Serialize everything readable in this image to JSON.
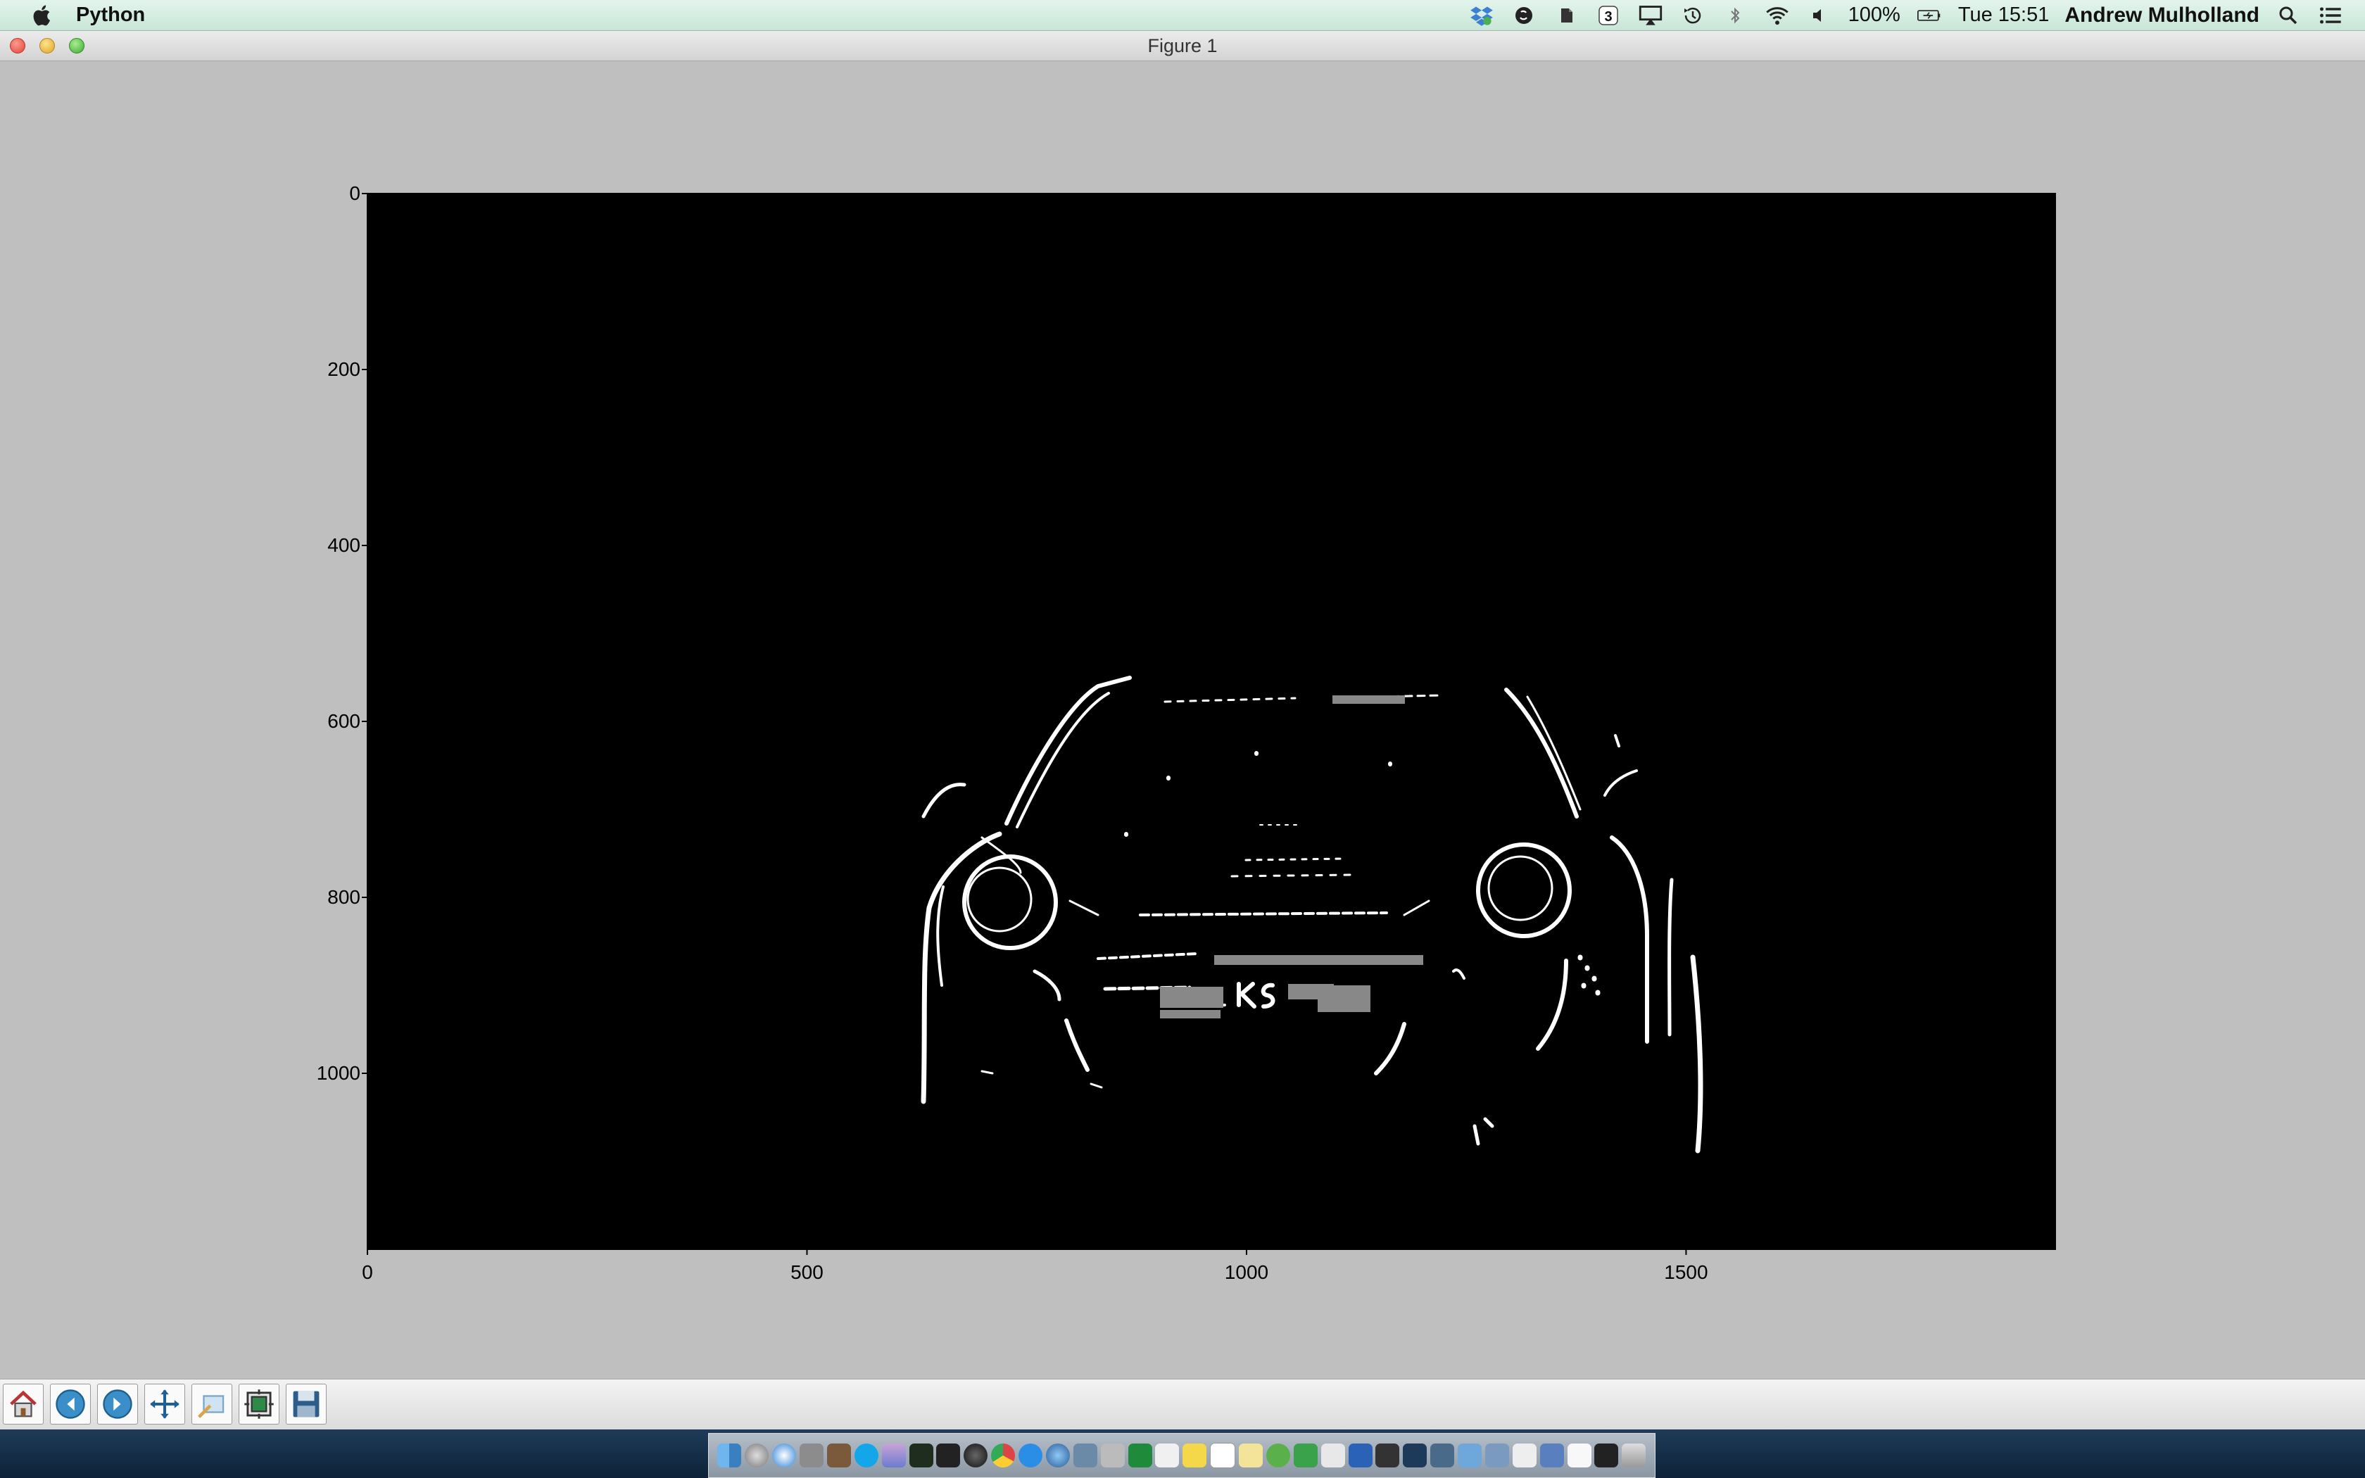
{
  "menubar": {
    "app_name": "Python",
    "status_items": [
      {
        "icon": "dropbox-icon"
      },
      {
        "icon": "skype-status-icon"
      },
      {
        "icon": "evernote-icon"
      },
      {
        "icon": "notification-count-icon",
        "text": "3"
      },
      {
        "icon": "airplay-icon"
      },
      {
        "icon": "time-machine-icon"
      },
      {
        "icon": "bluetooth-icon"
      },
      {
        "icon": "wifi-icon"
      },
      {
        "icon": "volume-icon"
      }
    ],
    "battery": "100%",
    "clock": "Tue 15:51",
    "user": "Andrew Mulholland"
  },
  "window": {
    "title": "Figure 1"
  },
  "figure": {
    "image_description_icon": "edge-detected-car-image",
    "colors": {
      "background": "#000000",
      "edges": "#ffffff",
      "plate": "#888888"
    },
    "chart_data": {
      "type": "image",
      "x_ticks": [
        0,
        500,
        1000,
        1500
      ],
      "y_ticks": [
        0,
        200,
        400,
        600,
        800,
        1000
      ],
      "xlim": [
        0,
        1920
      ],
      "ylim": [
        1200,
        0
      ]
    }
  },
  "toolbar": {
    "buttons": [
      {
        "name": "home-button",
        "icon": "home-icon"
      },
      {
        "name": "back-button",
        "icon": "back-arrow-icon"
      },
      {
        "name": "forward-button",
        "icon": "forward-arrow-icon"
      },
      {
        "name": "pan-button",
        "icon": "pan-icon"
      },
      {
        "name": "zoom-button",
        "icon": "zoom-rect-icon"
      },
      {
        "name": "subplots-button",
        "icon": "subplots-icon"
      },
      {
        "name": "save-button",
        "icon": "save-icon"
      }
    ]
  }
}
